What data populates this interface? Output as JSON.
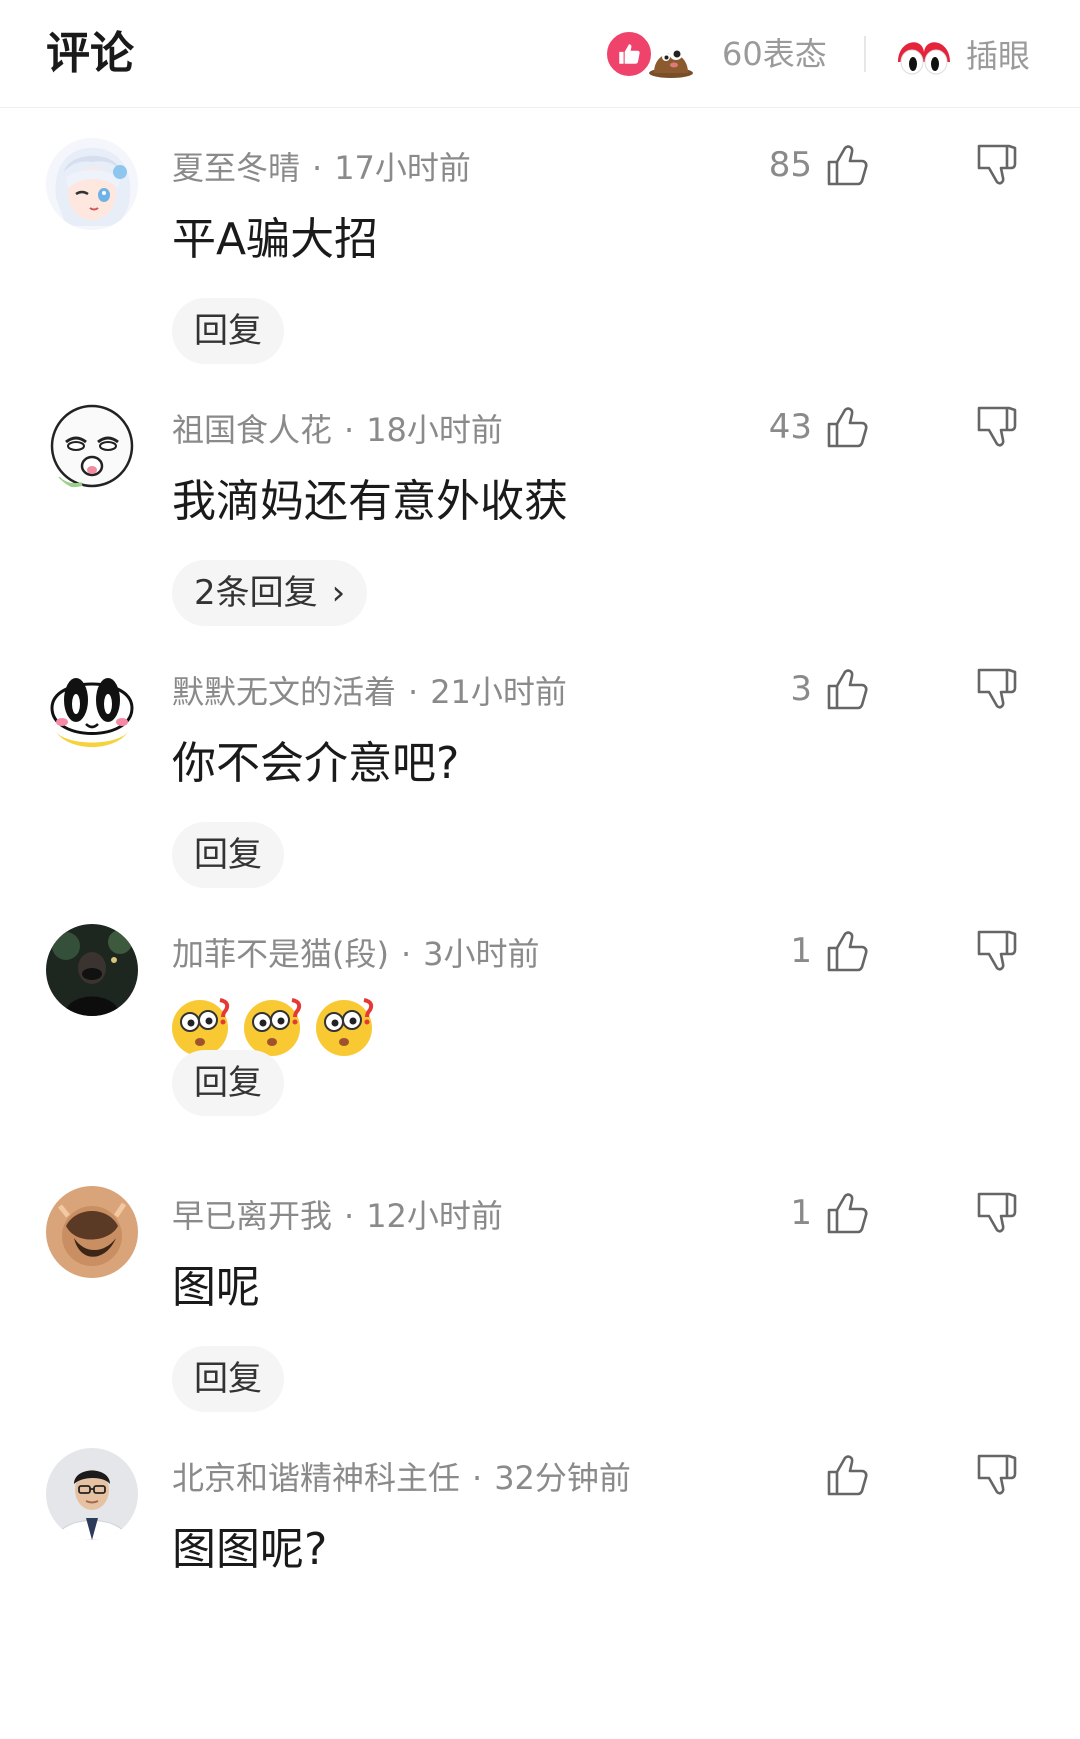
{
  "header": {
    "title": "评论",
    "reaction_count": "60表态",
    "peek_label": "插眼"
  },
  "comments": [
    {
      "username": "夏至冬晴",
      "time": "17小时前",
      "likes": "85",
      "text": "平A骗大招",
      "reply_label": "回复",
      "avatar": "anime-girl-avatar"
    },
    {
      "username": "祖国食人花",
      "time": "18小时前",
      "likes": "43",
      "text": "我滴妈还有意外收获",
      "reply_label": "2条回复",
      "avatar": "cartoon-face-avatar"
    },
    {
      "username": "默默无文的活着",
      "time": "21小时前",
      "likes": "3",
      "text": "你不会介意吧?",
      "reply_label": "回复",
      "avatar": "big-eyes-avatar"
    },
    {
      "username": "加菲不是猫(段)",
      "time": "3小时前",
      "likes": "1",
      "text": "",
      "emojis": [
        "dizzy-face-emoji",
        "dizzy-face-emoji",
        "dizzy-face-emoji"
      ],
      "reply_label": "回复",
      "avatar": "night-photo-avatar"
    },
    {
      "username": "早已离开我",
      "time": "12小时前",
      "likes": "1",
      "text": "图呢",
      "reply_label": "回复",
      "avatar": "artwork-avatar"
    },
    {
      "username": "北京和谐精神科主任",
      "time": "32分钟前",
      "likes": "",
      "text": "图图呢?",
      "avatar": "doctor-photo-avatar"
    }
  ],
  "colors": {
    "accent_pink": "#f0436b",
    "meta_gray": "#8a8a8a",
    "reply_bg": "#f5f5f5"
  }
}
